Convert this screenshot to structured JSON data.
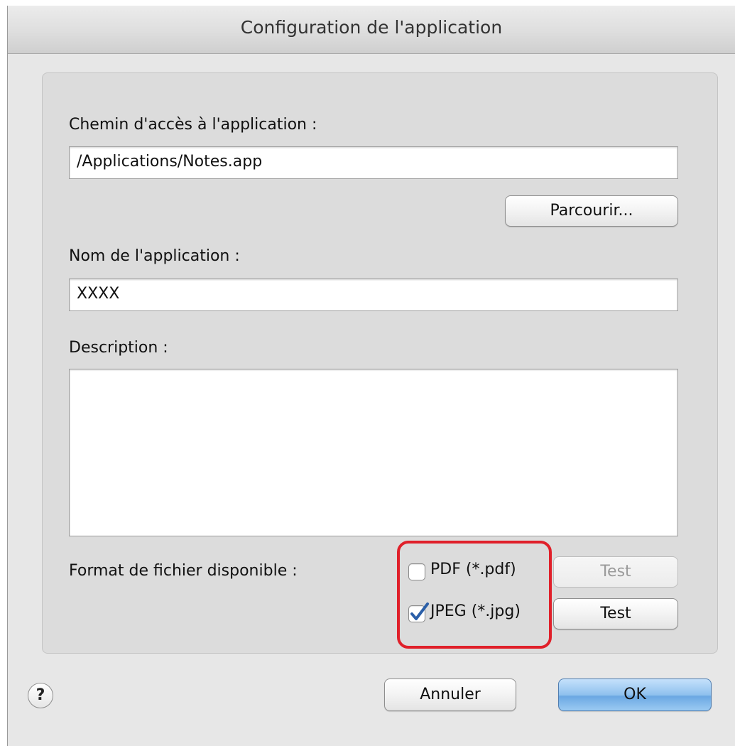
{
  "window": {
    "title": "Configuration de l'application"
  },
  "form": {
    "app_path_label": "Chemin d'accès à l'application :",
    "app_path_value": "/Applications/Notes.app",
    "browse_label": "Parcourir...",
    "app_name_label": "Nom de l'application :",
    "app_name_value": "XXXX",
    "description_label": "Description :",
    "description_value": "",
    "file_format_label": "Format de fichier disponible :",
    "formats": [
      {
        "label": "PDF (*.pdf)",
        "checked": false,
        "test_label": "Test",
        "test_enabled": false
      },
      {
        "label": "JPEG (*.jpg)",
        "checked": true,
        "test_label": "Test",
        "test_enabled": true
      }
    ]
  },
  "footer": {
    "help_label": "?",
    "cancel_label": "Annuler",
    "ok_label": "OK"
  },
  "colors": {
    "highlight": "#e0202a",
    "primary_button": "#8fc1ee",
    "checkmark": "#2b5fa8"
  },
  "icons": {
    "help": "help-icon",
    "checkmark": "checkmark-icon"
  }
}
